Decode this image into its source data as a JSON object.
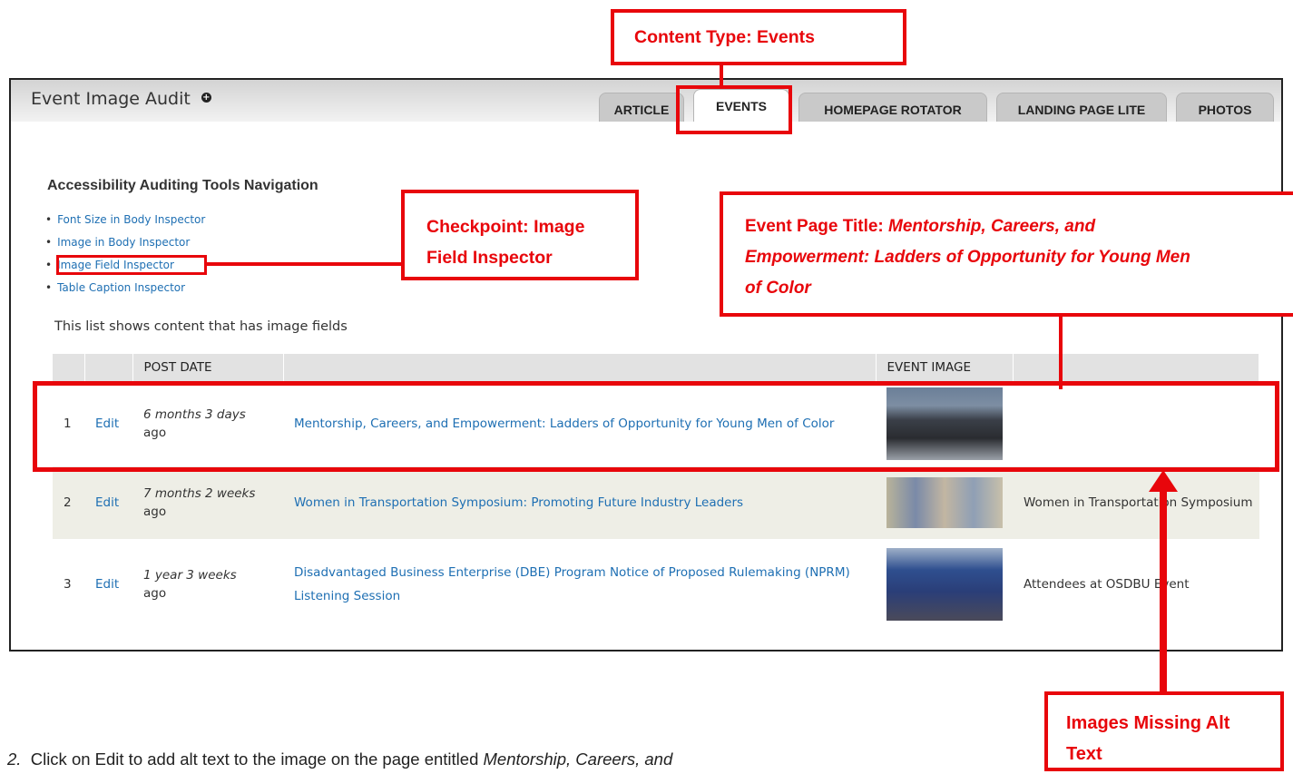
{
  "header": {
    "title": "Event Image Audit",
    "add_icon": "plus-circle-icon",
    "tabs": [
      {
        "label": "ARTICLE",
        "active": false
      },
      {
        "label": "EVENTS",
        "active": true
      },
      {
        "label": "HOMEPAGE ROTATOR",
        "active": false
      },
      {
        "label": "LANDING PAGE LITE",
        "active": false
      },
      {
        "label": "PHOTOS",
        "active": false
      }
    ]
  },
  "nav": {
    "title": "Accessibility Auditing Tools Navigation",
    "items": [
      "Font Size in Body Inspector",
      "Image in Body Inspector",
      "Image Field Inspector",
      "Table Caption Inspector"
    ]
  },
  "intro": "This list shows content that has image fields",
  "table": {
    "headers": [
      "",
      "",
      "POST DATE",
      "",
      "EVENT IMAGE",
      ""
    ],
    "rows": [
      {
        "num": "1",
        "edit": "Edit",
        "date": "6 months 3 days",
        "ago": "ago",
        "title": "Mentorship, Careers, and Empowerment: Ladders of Opportunity for Young Men of Color",
        "alt": ""
      },
      {
        "num": "2",
        "edit": "Edit",
        "date": "7 months 2 weeks",
        "ago": "ago",
        "title": "Women in Transportation Symposium: Promoting Future Industry Leaders",
        "alt": "Women in Transportation Symposium"
      },
      {
        "num": "3",
        "edit": "Edit",
        "date": "1 year 3 weeks",
        "ago": "ago",
        "title": "Disadvantaged Business Enterprise (DBE) Program Notice of Proposed Rulemaking (NPRM) Listening Session",
        "alt": "Attendees at OSDBU Event"
      }
    ]
  },
  "annotations": {
    "content_type": "Content Type: Events",
    "checkpoint_line1": "Checkpoint: Image",
    "checkpoint_line2": "Field Inspector",
    "event_title_label": "Event Page Title: ",
    "event_title_line1": "Mentorship, Careers, and",
    "event_title_line2": "Empowerment: Ladders of Opportunity for Young Men",
    "event_title_line3": "of Color",
    "missing_alt_line1": "Images Missing Alt",
    "missing_alt_line2": "Text",
    "accent_color": "#e8060b"
  },
  "footer": {
    "number": "2.",
    "text": "Click on Edit to add alt text to the image on the page entitled ",
    "italic": "Mentorship, Careers, and"
  }
}
